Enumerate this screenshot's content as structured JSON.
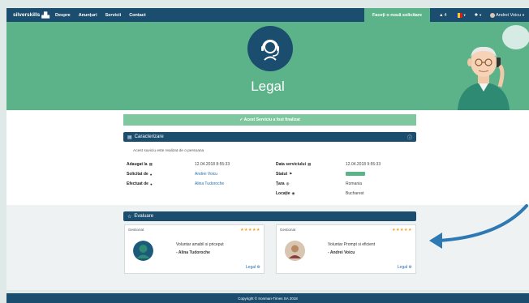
{
  "nav": {
    "logo_text": "silverskills",
    "links": [
      "Despre",
      "Anunțuri",
      "Servicii",
      "Contact"
    ],
    "cta": "Faceți o nouă solicitare",
    "notifications": "4",
    "user": "Andrei Voicu"
  },
  "hero": {
    "title": "Legal"
  },
  "alert": {
    "text": "✔ Acest Serviciu a fost finalizat"
  },
  "details": {
    "heading": "Caracterizare",
    "description": "Acest suviciu este realizat de o persoana",
    "rows": [
      {
        "label": "Adaugat la",
        "value": "12.04.2018 8:55:33"
      },
      {
        "label": "Solicitat de",
        "value": "Andrei Voicu"
      },
      {
        "label": "Efectuat de",
        "value": "Alina Tudoroche"
      }
    ],
    "rows_right": [
      {
        "label": "Data serviciului",
        "value": "12.04.2018 9:55:33"
      },
      {
        "label": "Statut",
        "value": ""
      },
      {
        "label": "Țara",
        "value": "Romania"
      },
      {
        "label": "Locație",
        "value": "Bucharest"
      }
    ]
  },
  "evaluation": {
    "heading": "Evaluare",
    "cards": [
      {
        "title": "Gestionat",
        "quote": "Voluntar amabil si priceput",
        "author": "- Alina Tudoroche",
        "link": "Legal",
        "stars": "★★★★★"
      },
      {
        "title": "Gestionat",
        "quote": "Voluntar Prompt si eficient",
        "author": "- Andrei Voicu",
        "link": "Legal",
        "stars": "★★★★★"
      }
    ]
  },
  "footer": {
    "text": "Copyright © Ironman-Times SA 2018"
  },
  "colors": {
    "navy": "#1b4d6e",
    "green": "#5cb38a",
    "alert": "#7ec79f",
    "stars": "#f0a020"
  }
}
